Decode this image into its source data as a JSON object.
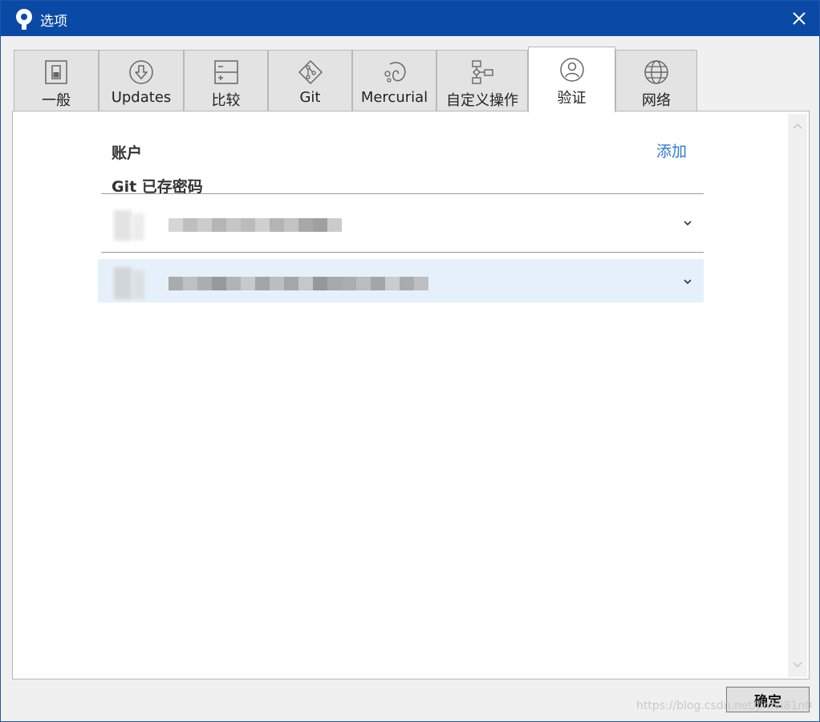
{
  "window": {
    "title": "选项"
  },
  "tabs": [
    {
      "label": "一般",
      "icon": "toggle-switch-icon"
    },
    {
      "label": "Updates",
      "icon": "download-circle-icon"
    },
    {
      "label": "比较",
      "icon": "diff-icon"
    },
    {
      "label": "Git",
      "icon": "git-icon"
    },
    {
      "label": "Mercurial",
      "icon": "mercurial-icon"
    },
    {
      "label": "自定义操作",
      "icon": "flowchart-icon"
    },
    {
      "label": "验证",
      "icon": "user-circle-icon",
      "active": true
    },
    {
      "label": "网络",
      "icon": "globe-icon"
    }
  ],
  "auth": {
    "accounts_title": "账户",
    "add_label": "添加",
    "git_passwords_title": "Git 已存密码"
  },
  "footer": {
    "ok_label": "确定"
  },
  "watermark": "https://blog.csdn.net/Jimvi81n0",
  "colors": {
    "titlebar": "#0a4aa6",
    "link": "#2f7bd3",
    "selected_row": "#e5f0fa"
  }
}
